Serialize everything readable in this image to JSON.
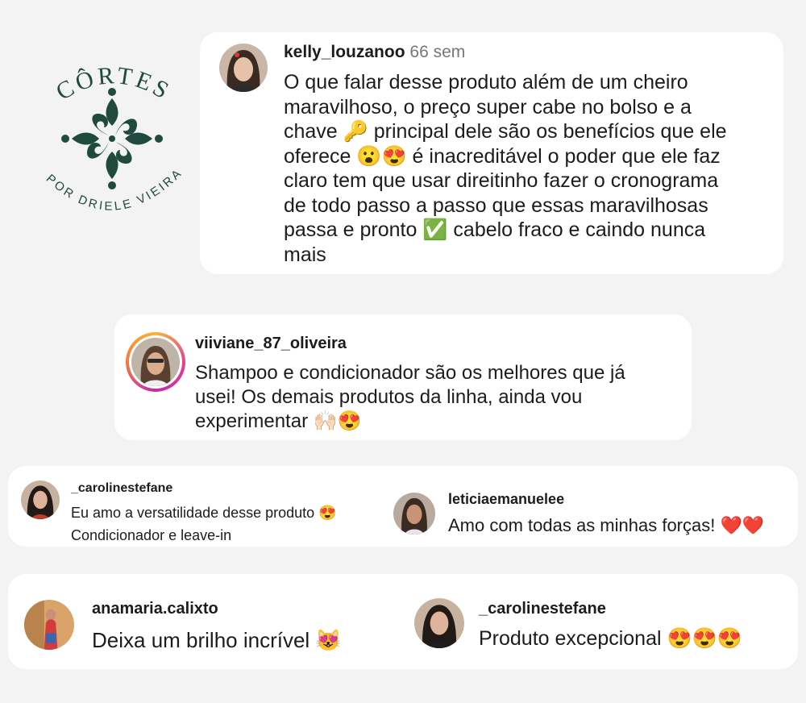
{
  "logo": {
    "brand": "CÔRTES",
    "tagline": "POR DRIELE VIEIRA",
    "color": "#1f4a3d"
  },
  "comments": [
    {
      "username": "kelly_louzanoo",
      "time": "66 sem",
      "text": "O que falar desse produto além de um cheiro\nmaravilhoso, o preço super cabe no bolso e a\nchave 🔑 principal dele são os benefícios que ele\noferece 😮😍 é inacreditável o poder que ele faz\nclaro tem que usar direitinho fazer o cronograma\nde todo passo a passo que essas maravilhosas\npassa e pronto ✅ cabelo fraco e caindo nunca\nmais"
    },
    {
      "username": "viiviane_87_oliveira",
      "text": "Shampoo e condicionador são os melhores que já\nusei! Os demais produtos da linha, ainda vou\nexperimentar 🙌🏻😍"
    },
    {
      "username": "_carolinestefane",
      "text": "Eu amo a versatilidade desse produto 😍\nCondicionador e leave-in"
    },
    {
      "username": "leticiaemanuelee",
      "text": "Amo com todas as minhas forças! ❤️❤️"
    },
    {
      "username": "anamaria.calixto",
      "text": "Deixa um brilho incrível 😻"
    },
    {
      "username": "_carolinestefane",
      "text": "Produto excepcional 😍😍😍"
    }
  ]
}
